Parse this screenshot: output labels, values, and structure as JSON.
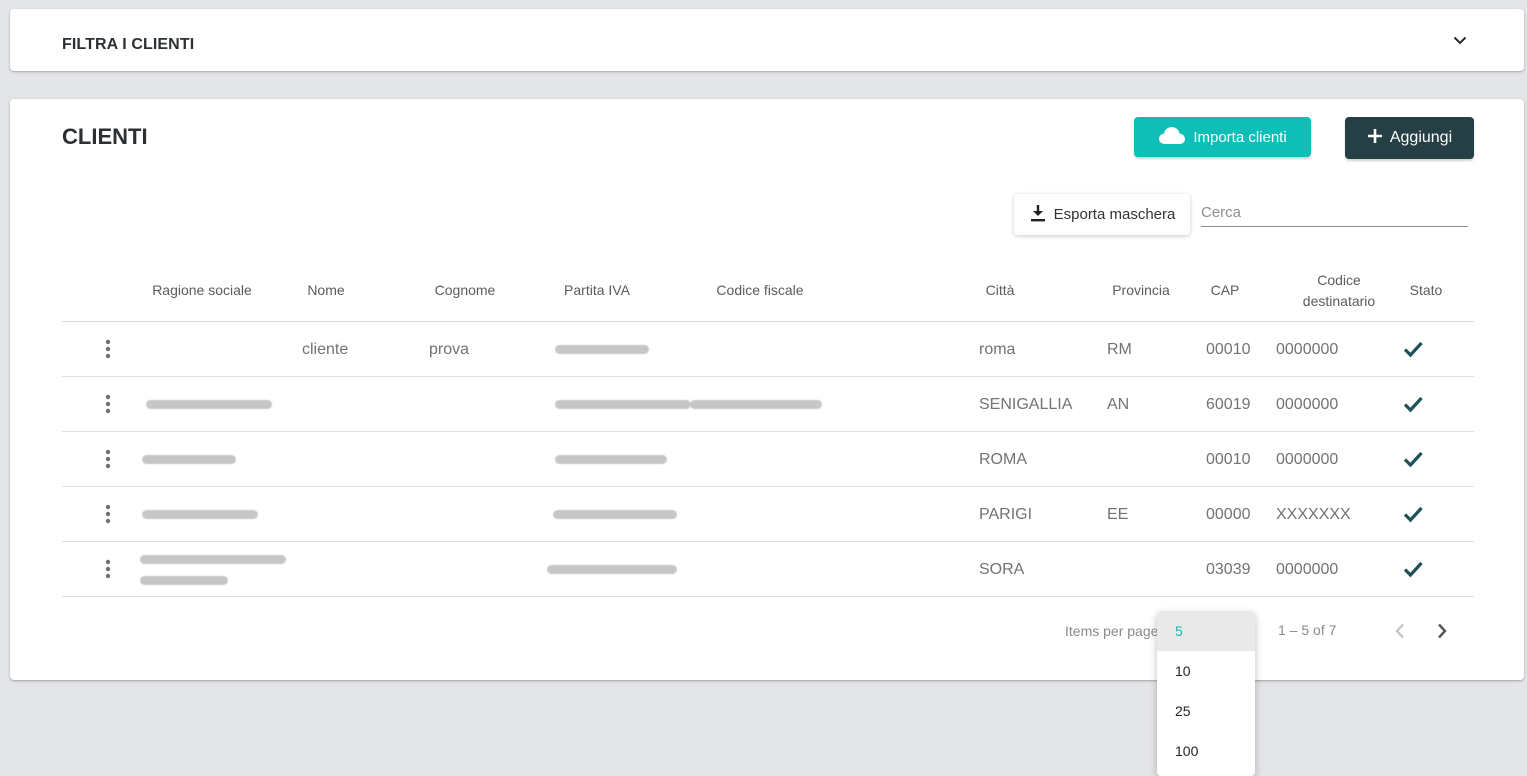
{
  "filter": {
    "title": "FILTRA I CLIENTI"
  },
  "clients": {
    "title": "CLIENTI",
    "import_label": "Importa clienti",
    "add_label": "Aggiungi",
    "export_label": "Esporta maschera",
    "search_placeholder": "Cerca"
  },
  "table": {
    "headers": {
      "ragione_sociale": "Ragione sociale",
      "nome": "Nome",
      "cognome": "Cognome",
      "partita_iva": "Partita IVA",
      "codice_fiscale": "Codice fiscale",
      "citta": "Città",
      "provincia": "Provincia",
      "cap": "CAP",
      "codice_destinatario": "Codice destinatario",
      "stato": "Stato"
    },
    "rows": [
      {
        "nome": "cliente",
        "cognome": "prova",
        "citta": "roma",
        "provincia": "RM",
        "cap": "00010",
        "codice_destinatario": "0000000"
      },
      {
        "nome": "",
        "cognome": "",
        "citta": "SENIGALLIA",
        "provincia": "AN",
        "cap": "60019",
        "codice_destinatario": "0000000"
      },
      {
        "nome": "",
        "cognome": "",
        "citta": "ROMA",
        "provincia": "",
        "cap": "00010",
        "codice_destinatario": "0000000"
      },
      {
        "nome": "",
        "cognome": "",
        "citta": "PARIGI",
        "provincia": "EE",
        "cap": "00000",
        "codice_destinatario": "XXXXXXX"
      },
      {
        "nome": "",
        "cognome": "",
        "citta": "SORA",
        "provincia": "",
        "cap": "03039",
        "codice_destinatario": "0000000"
      }
    ]
  },
  "paginator": {
    "items_per_page_label": "Items per page",
    "range_label": "1 – 5 of 7",
    "options": [
      "5",
      "10",
      "25",
      "100"
    ]
  },
  "colors": {
    "accent": "#0fbeb7",
    "dark": "#253f45",
    "check": "#1f5158"
  }
}
